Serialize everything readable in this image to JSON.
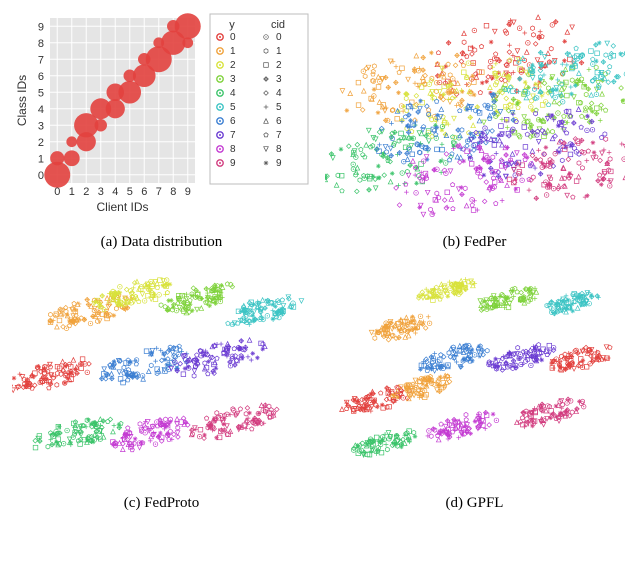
{
  "captions": {
    "a": "(a) Data distribution",
    "b": "(b) FedPer",
    "c": "(c) FedProto",
    "d": "(d) GPFL"
  },
  "legend": {
    "y_title": "y",
    "cid_title": "cid",
    "items": [
      "0",
      "1",
      "2",
      "3",
      "4",
      "5",
      "6",
      "7",
      "8",
      "9"
    ]
  },
  "axis": {
    "x_label": "Client IDs",
    "y_label": "Class IDs",
    "ticks": [
      "0",
      "1",
      "2",
      "3",
      "4",
      "5",
      "6",
      "7",
      "8",
      "9"
    ]
  },
  "colors": {
    "series": [
      "#e2413e",
      "#f0a23c",
      "#d8e23c",
      "#7fd23c",
      "#3cc46b",
      "#3cc4c4",
      "#3c7fd2",
      "#6b3cd2",
      "#c43cd2",
      "#d23c7f"
    ],
    "bubble": "#e2413e",
    "grid_bg": "#e5e5e5",
    "grid_line": "#ffffff",
    "legend_border": "#bdbdbd"
  },
  "chart_data": [
    {
      "type": "scatter",
      "title": "Data distribution",
      "xlabel": "Client IDs",
      "ylabel": "Class IDs",
      "x_ticks": [
        0,
        1,
        2,
        3,
        4,
        5,
        6,
        7,
        8,
        9
      ],
      "y_ticks": [
        0,
        1,
        2,
        3,
        4,
        5,
        6,
        7,
        8,
        9
      ],
      "points": [
        {
          "client": 0,
          "class": 0,
          "size": 26
        },
        {
          "client": 0,
          "class": 1,
          "size": 12
        },
        {
          "client": 1,
          "class": 1,
          "size": 14
        },
        {
          "client": 1,
          "class": 2,
          "size": 8
        },
        {
          "client": 2,
          "class": 2,
          "size": 18
        },
        {
          "client": 2,
          "class": 3,
          "size": 24
        },
        {
          "client": 3,
          "class": 3,
          "size": 10
        },
        {
          "client": 3,
          "class": 4,
          "size": 20
        },
        {
          "client": 4,
          "class": 4,
          "size": 18
        },
        {
          "client": 4,
          "class": 5,
          "size": 16
        },
        {
          "client": 5,
          "class": 5,
          "size": 22
        },
        {
          "client": 5,
          "class": 6,
          "size": 10
        },
        {
          "client": 6,
          "class": 6,
          "size": 22
        },
        {
          "client": 6,
          "class": 7,
          "size": 10
        },
        {
          "client": 7,
          "class": 7,
          "size": 26
        },
        {
          "client": 7,
          "class": 8,
          "size": 8
        },
        {
          "client": 8,
          "class": 8,
          "size": 24
        },
        {
          "client": 8,
          "class": 9,
          "size": 10
        },
        {
          "client": 9,
          "class": 8,
          "size": 8
        },
        {
          "client": 9,
          "class": 9,
          "size": 26
        }
      ]
    },
    {
      "type": "scatter",
      "title": "FedPer",
      "clusters": [
        {
          "cx": 0.62,
          "cy": 0.2,
          "r": 0.2,
          "seed": 11
        },
        {
          "cx": 0.28,
          "cy": 0.35,
          "r": 0.18,
          "seed": 21
        },
        {
          "cx": 0.5,
          "cy": 0.4,
          "r": 0.2,
          "seed": 31
        },
        {
          "cx": 0.78,
          "cy": 0.42,
          "r": 0.18,
          "seed": 41
        },
        {
          "cx": 0.2,
          "cy": 0.7,
          "r": 0.18,
          "seed": 51
        },
        {
          "cx": 0.82,
          "cy": 0.28,
          "r": 0.16,
          "seed": 61
        },
        {
          "cx": 0.4,
          "cy": 0.55,
          "r": 0.18,
          "seed": 71
        },
        {
          "cx": 0.7,
          "cy": 0.62,
          "r": 0.18,
          "seed": 81
        },
        {
          "cx": 0.45,
          "cy": 0.8,
          "r": 0.18,
          "seed": 91
        },
        {
          "cx": 0.85,
          "cy": 0.75,
          "r": 0.16,
          "seed": 101
        }
      ]
    },
    {
      "type": "scatter",
      "title": "FedProto",
      "clusters": [
        {
          "cx": 0.1,
          "cy": 0.5,
          "r": 0.11,
          "seed": 12
        },
        {
          "cx": 0.24,
          "cy": 0.2,
          "r": 0.11,
          "seed": 22
        },
        {
          "cx": 0.4,
          "cy": 0.12,
          "r": 0.1,
          "seed": 32
        },
        {
          "cx": 0.63,
          "cy": 0.14,
          "r": 0.1,
          "seed": 42
        },
        {
          "cx": 0.2,
          "cy": 0.78,
          "r": 0.11,
          "seed": 52
        },
        {
          "cx": 0.85,
          "cy": 0.2,
          "r": 0.1,
          "seed": 62
        },
        {
          "cx": 0.45,
          "cy": 0.45,
          "r": 0.12,
          "seed": 72
        },
        {
          "cx": 0.7,
          "cy": 0.42,
          "r": 0.12,
          "seed": 82
        },
        {
          "cx": 0.45,
          "cy": 0.78,
          "r": 0.11,
          "seed": 92
        },
        {
          "cx": 0.75,
          "cy": 0.72,
          "r": 0.11,
          "seed": 102
        }
      ]
    },
    {
      "type": "scatter",
      "title": "GPFL",
      "clusters": [
        {
          "cx": 0.15,
          "cy": 0.62,
          "r": 0.09,
          "seed": 13
        },
        {
          "cx": 0.24,
          "cy": 0.28,
          "r": 0.08,
          "seed": 23
        },
        {
          "cx": 0.4,
          "cy": 0.1,
          "r": 0.07,
          "seed": 33
        },
        {
          "cx": 0.62,
          "cy": 0.14,
          "r": 0.08,
          "seed": 43
        },
        {
          "cx": 0.18,
          "cy": 0.82,
          "r": 0.08,
          "seed": 53
        },
        {
          "cx": 0.84,
          "cy": 0.16,
          "r": 0.07,
          "seed": 63
        },
        {
          "cx": 0.42,
          "cy": 0.42,
          "r": 0.09,
          "seed": 73
        },
        {
          "cx": 0.66,
          "cy": 0.42,
          "r": 0.09,
          "seed": 83
        },
        {
          "cx": 0.46,
          "cy": 0.74,
          "r": 0.09,
          "seed": 93
        },
        {
          "cx": 0.76,
          "cy": 0.68,
          "r": 0.09,
          "seed": 103
        },
        {
          "cx": 0.88,
          "cy": 0.42,
          "r": 0.08,
          "seed": 113
        },
        {
          "cx": 0.32,
          "cy": 0.56,
          "r": 0.08,
          "seed": 123
        }
      ]
    }
  ]
}
